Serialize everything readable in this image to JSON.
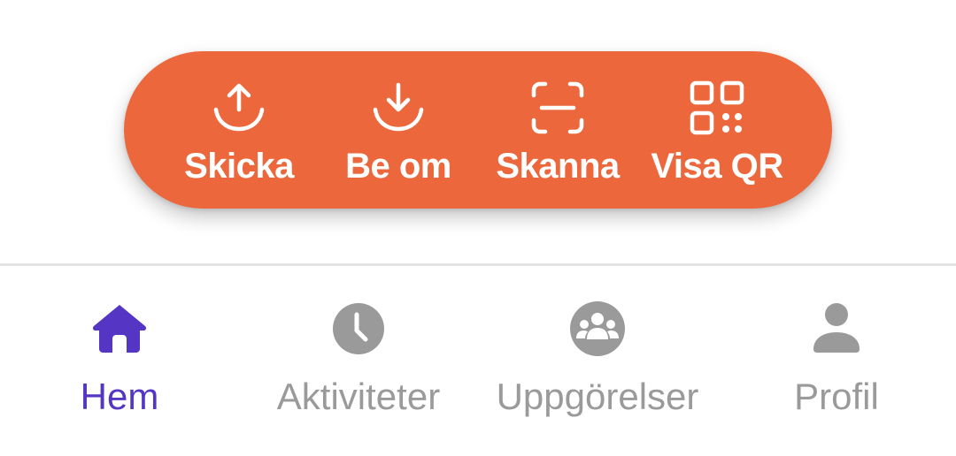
{
  "colors": {
    "accent_orange": "#ec683c",
    "active_nav": "#5536c4",
    "inactive_nav": "#9a9a9a",
    "divider": "#e3e3e3"
  },
  "action_bar": {
    "items": [
      {
        "label": "Skicka",
        "icon": "upload-icon"
      },
      {
        "label": "Be om",
        "icon": "download-icon"
      },
      {
        "label": "Skanna",
        "icon": "scan-icon"
      },
      {
        "label": "Visa QR",
        "icon": "qr-code-icon"
      }
    ]
  },
  "bottom_nav": {
    "active_index": 0,
    "items": [
      {
        "label": "Hem",
        "icon": "home-icon"
      },
      {
        "label": "Aktiviteter",
        "icon": "clock-icon"
      },
      {
        "label": "Uppgörelser",
        "icon": "group-icon"
      },
      {
        "label": "Profil",
        "icon": "person-icon"
      }
    ]
  }
}
